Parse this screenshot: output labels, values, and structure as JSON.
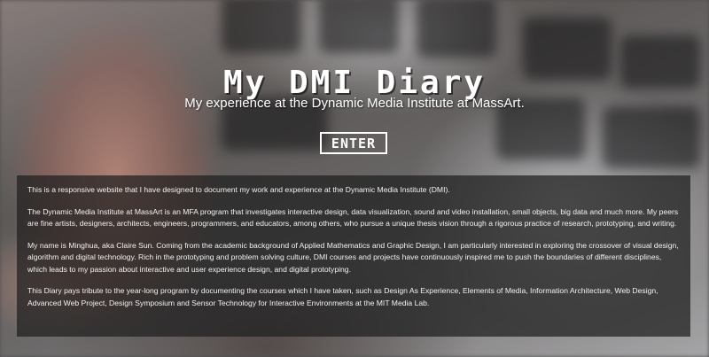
{
  "hero": {
    "title": "My DMI Diary",
    "subtitle": "My experience at the Dynamic Media Institute at MassArt.",
    "enter_label": "ENTER"
  },
  "about": {
    "paragraphs": [
      "This is a responsive website that I have designed to document my work and experience at the Dynamic Media Institute (DMI).",
      "The Dynamic Media Institute at MassArt is an MFA program that investigates interactive design, data visualization, sound and video installation, small objects, big data and much more. My peers are fine artists, designers, architects, engineers, programmers, and educators, among others, who pursue a unique thesis vision through a rigorous practice of research, prototyping, and writing.",
      "My name is Minghua, aka Claire Sun. Coming from the academic background of Applied Mathematics and Graphic Design, I am particularly interested in exploring the crossover of visual design, algorithm and digital technology. Rich in the prototyping and problem solving culture, DMI courses and projects have continuously inspired me to push the boundaries of different disciplines, which leads to my passion about interactive and user experience design, and digital prototyping.",
      "This Diary pays tribute to the year-long program by documenting the courses which I have taken, such as Design As Experience, Elements of Media, Information Architecture, Web Design, Advanced Web Project, Design Symposium and Sensor Technology for Interactive Environments at the MIT Media Lab."
    ]
  },
  "colors": {
    "text": "#ffffff",
    "panel": "#1e1e1e"
  }
}
